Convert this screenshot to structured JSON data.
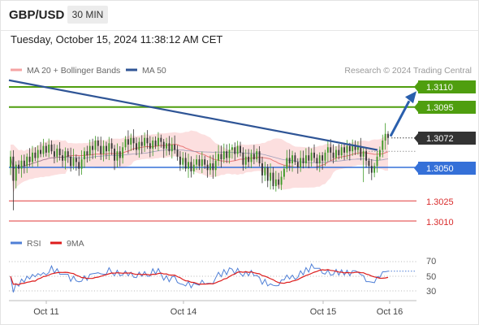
{
  "header": {
    "pair": "GBP/USD",
    "timeframe": "30 MIN"
  },
  "timestamp": "Tuesday, October 15, 2024 11:38:12 AM CET",
  "legend": {
    "ma20_bollinger": "MA 20 + Bollinger Bands",
    "ma50": "MA 50",
    "research": "Research © 2024 Trading Central",
    "rsi": "RSI",
    "rsi_ma": "9MA"
  },
  "levels": {
    "r2": "1.3110",
    "r1": "1.3095",
    "current": "1.3072",
    "pivot": "1.3050",
    "s1": "1.3025",
    "s2": "1.3010"
  },
  "x_labels": [
    "Oct 11",
    "Oct 14",
    "Oct 15",
    "Oct 16"
  ],
  "rsi_labels": [
    "70",
    "50",
    "30"
  ],
  "colors": {
    "resistance": "#4f9e0f",
    "support": "#e03a3a",
    "pivot": "#3570d8",
    "current": "#333333",
    "ma50": "#2f5596",
    "ma20": "#e87a7a",
    "bands": "#fcd9d9",
    "candle_up": "#3d9a25",
    "candle_down": "#333333",
    "rsi": "#4f7fd6",
    "rsi_ma": "#dd1c1c"
  },
  "chart_data": {
    "type": "candlestick",
    "instrument": "GBP/USD",
    "interval": "30 MIN",
    "y_range": [
      1.2996,
      1.3125
    ],
    "x_ticks": [
      "Oct 11",
      "Oct 14",
      "Oct 15",
      "Oct 16"
    ],
    "candles_close": [
      1.3058,
      1.304,
      1.3052,
      1.3049,
      1.3055,
      1.3051,
      1.3058,
      1.3054,
      1.3061,
      1.3057,
      1.3063,
      1.306,
      1.3066,
      1.3061,
      1.3067,
      1.3062,
      1.3058,
      1.3064,
      1.3059,
      1.3055,
      1.3062,
      1.3058,
      1.3051,
      1.3057,
      1.3054,
      1.3049,
      1.3056,
      1.3062,
      1.3059,
      1.3066,
      1.3063,
      1.307,
      1.3066,
      1.306,
      1.3066,
      1.3062,
      1.3068,
      1.3064,
      1.3055,
      1.3062,
      1.3057,
      1.3065,
      1.3071,
      1.3067,
      1.3072,
      1.3068,
      1.3063,
      1.3069,
      1.3066,
      1.3072,
      1.3068,
      1.3064,
      1.307,
      1.3066,
      1.3072,
      1.3069,
      1.3064,
      1.3068,
      1.3062,
      1.3067,
      1.3063,
      1.3058,
      1.3052,
      1.3057,
      1.3049,
      1.3054,
      1.3047,
      1.3052,
      1.3056,
      1.3051,
      1.3056,
      1.3052,
      1.3048,
      1.3053,
      1.3048,
      1.3055,
      1.306,
      1.3056,
      1.3062,
      1.3057,
      1.3063,
      1.3065,
      1.306,
      1.3066,
      1.3061,
      1.3052,
      1.3058,
      1.3054,
      1.306,
      1.3056,
      1.3062,
      1.3053,
      1.3044,
      1.305,
      1.304,
      1.3046,
      1.3036,
      1.3041,
      1.3037,
      1.3043,
      1.3049,
      1.3057,
      1.3053,
      1.3059,
      1.3054,
      1.305,
      1.3057,
      1.3053,
      1.3059,
      1.3055,
      1.3061,
      1.3057,
      1.3053,
      1.3059,
      1.3055,
      1.3061,
      1.3065,
      1.3061,
      1.3057,
      1.3063,
      1.3059,
      1.3065,
      1.3061,
      1.3066,
      1.3062,
      1.3067,
      1.3063,
      1.3066,
      1.3058,
      1.3062,
      1.3055,
      1.3051,
      1.3046,
      1.3051,
      1.3058,
      1.3063,
      1.307,
      1.3075,
      1.3072
    ],
    "ma50_trendline": {
      "from": 1.3115,
      "to": 1.3063
    },
    "forecast_arrow": {
      "from": 1.3072,
      "to": 1.3108
    },
    "rsi_axis": [
      30,
      50,
      70
    ],
    "rsi_last": 62
  }
}
